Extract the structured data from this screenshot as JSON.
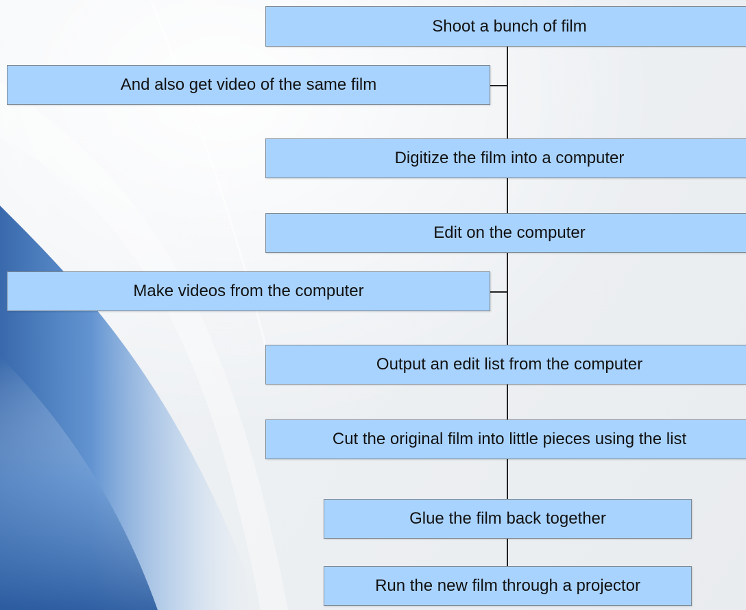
{
  "diagram": {
    "steps": [
      {
        "label": "Shoot a bunch of film"
      },
      {
        "label": "And also get video of the same film"
      },
      {
        "label": "Digitize the film into a computer"
      },
      {
        "label": "Edit on the computer"
      },
      {
        "label": "Make videos from the computer"
      },
      {
        "label": "Output an edit list from the computer"
      },
      {
        "label": "Cut the original film into little pieces using the list"
      },
      {
        "label": "Glue the film back together"
      },
      {
        "label": "Run the new film through a projector"
      }
    ]
  },
  "colors": {
    "box_fill": "#a9d3ff",
    "box_border": "#7e8a96",
    "connector": "#222222",
    "background_accent": "#3f74b8"
  }
}
